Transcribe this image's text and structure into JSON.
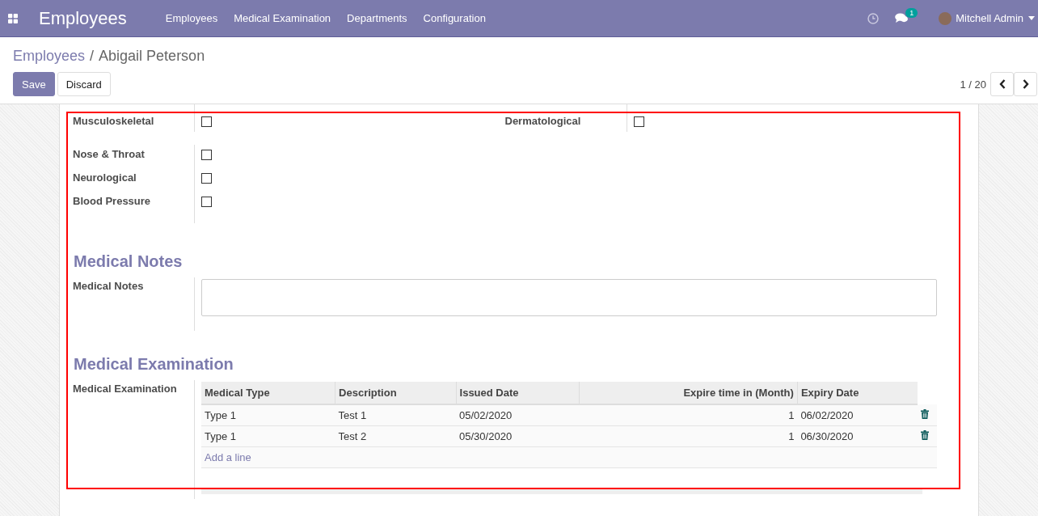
{
  "navbar": {
    "app_title": "Employees",
    "menu": [
      {
        "label": "Employees"
      },
      {
        "label": "Medical Examination"
      },
      {
        "label": "Departments"
      },
      {
        "label": "Configuration"
      }
    ],
    "messages_count": "1",
    "user": "Mitchell Admin"
  },
  "breadcrumb_separator": "/",
  "breadcrumb": [
    {
      "label": "Employees",
      "kind": "link"
    },
    {
      "label": "Abigail Peterson",
      "kind": "current"
    }
  ],
  "buttons": [
    {
      "label": "Save",
      "kind": "primary"
    },
    {
      "label": "Discard",
      "kind": "secondary"
    }
  ],
  "pager": "1 / 20",
  "checks_top": [
    {
      "label": "Musculoskeletal",
      "checked": false
    },
    {
      "label": "Dermatological",
      "checked": false
    }
  ],
  "checks": [
    {
      "label": "Nose & Throat",
      "checked": false
    },
    {
      "label": "Neurological",
      "checked": false
    },
    {
      "label": "Blood Pressure",
      "checked": false
    }
  ],
  "notes_section": {
    "heading": "Medical Notes",
    "label": "Medical Notes"
  },
  "exam_section": {
    "heading": "Medical Examination",
    "label": "Medical Examination",
    "columns": [
      "Medical Type",
      "Description",
      "Issued Date",
      "Expire time in (Month)",
      "Expiry Date"
    ],
    "rows": [
      [
        "Type 1",
        "Test 1",
        "05/02/2020",
        "1",
        "06/02/2020"
      ],
      [
        "Type 1",
        "Test 2",
        "05/30/2020",
        "1",
        "06/30/2020"
      ]
    ],
    "add_line": "Add a line"
  },
  "highlight": true
}
